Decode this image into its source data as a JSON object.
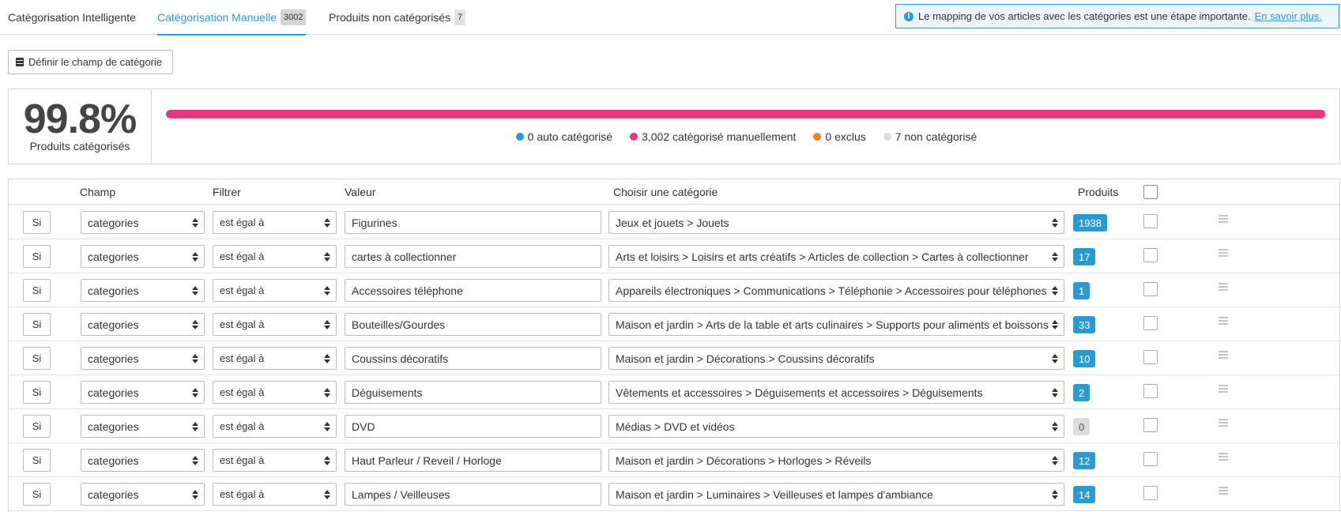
{
  "tabs": [
    {
      "label": "Catégorisation Intelligente",
      "count": ""
    },
    {
      "label": "Catégorisation Manuelle",
      "count": "3002"
    },
    {
      "label": "Produits non catégorisés",
      "count": "7"
    }
  ],
  "info": {
    "text": "Le mapping de vos articles avec les catégories est une étape importante.",
    "link": "En savoir plus."
  },
  "define_button": "Définir le champ de catégorie",
  "stats": {
    "percent": "99.8%",
    "label": "Produits catégorisés",
    "progress_fraction": 0.998,
    "legend": [
      {
        "text": "0 auto catégorisé",
        "color": "#2c9ad1"
      },
      {
        "text": "3,002 catégorisé manuellement",
        "color": "#e2397f"
      },
      {
        "text": "0 exclus",
        "color": "#ef8223"
      },
      {
        "text": "7 non catégorisé",
        "color": "#dcdcdc"
      }
    ]
  },
  "table": {
    "headers": {
      "champ": "Champ",
      "filtrer": "Filtrer",
      "valeur": "Valeur",
      "categorie": "Choisir une catégorie",
      "produits": "Produits"
    },
    "rows": [
      {
        "si": "Si",
        "champ": "categories",
        "filter": "est égal à",
        "value": "Figurines",
        "category": "Jeux et jouets > Jouets",
        "count": "1938"
      },
      {
        "si": "Si",
        "champ": "categories",
        "filter": "est égal à",
        "value": "cartes à collectionner",
        "category": "Arts et loisirs > Loisirs et arts créatifs > Articles de collection > Cartes à collectionner",
        "count": "17"
      },
      {
        "si": "Si",
        "champ": "categories",
        "filter": "est égal à",
        "value": "Accessoires téléphone",
        "category": "Appareils électroniques > Communications > Téléphonie > Accessoires pour téléphones",
        "count": "1"
      },
      {
        "si": "Si",
        "champ": "categories",
        "filter": "est égal à",
        "value": "Bouteilles/Gourdes",
        "category": "Maison et jardin > Arts de la table et arts culinaires > Supports pour aliments et boissons",
        "count": "33"
      },
      {
        "si": "Si",
        "champ": "categories",
        "filter": "est égal à",
        "value": "Coussins décoratifs",
        "category": "Maison et jardin > Décorations > Coussins décoratifs",
        "count": "10"
      },
      {
        "si": "Si",
        "champ": "categories",
        "filter": "est égal à",
        "value": "Déguisements",
        "category": "Vêtements et accessoires > Déguisements et accessoires > Déguisements",
        "count": "2"
      },
      {
        "si": "Si",
        "champ": "categories",
        "filter": "est égal à",
        "value": "DVD",
        "category": "Médias > DVD et vidéos",
        "count": "0"
      },
      {
        "si": "Si",
        "champ": "categories",
        "filter": "est égal à",
        "value": "Haut Parleur / Reveil / Horloge",
        "category": "Maison et jardin > Décorations > Horloges > Réveils",
        "count": "12"
      },
      {
        "si": "Si",
        "champ": "categories",
        "filter": "est égal à",
        "value": "Lampes / Veilleuses",
        "category": "Maison et jardin > Luminaires > Veilleuses et lampes d'ambiance",
        "count": "14"
      }
    ]
  }
}
